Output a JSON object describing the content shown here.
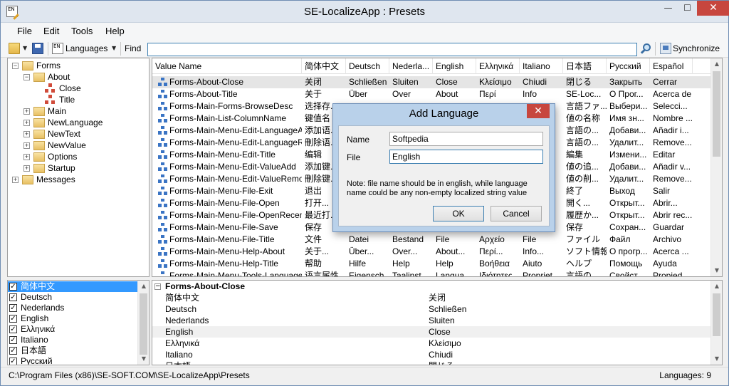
{
  "window": {
    "title": "SE-LocalizeApp : Presets",
    "icon_text": "EN",
    "min_symbol": "—",
    "max_symbol": "☐",
    "close_symbol": "✕"
  },
  "menu": [
    "File",
    "Edit",
    "Tools",
    "Help"
  ],
  "toolbar": {
    "languages_label": "Languages",
    "lang_icon_text": "EN",
    "find_label": "Find",
    "find_value": "",
    "sync_label": "Synchronize"
  },
  "tree": [
    {
      "label": "Forms",
      "expander": "−",
      "type": "folder"
    },
    {
      "label": "About",
      "expander": "−",
      "type": "folder"
    },
    {
      "label": "Close",
      "expander": "",
      "type": "leaf"
    },
    {
      "label": "Title",
      "expander": "",
      "type": "leaf"
    },
    {
      "label": "Main",
      "expander": "+",
      "type": "folder"
    },
    {
      "label": "NewLanguage",
      "expander": "+",
      "type": "folder"
    },
    {
      "label": "NewText",
      "expander": "+",
      "type": "folder"
    },
    {
      "label": "NewValue",
      "expander": "+",
      "type": "folder"
    },
    {
      "label": "Options",
      "expander": "+",
      "type": "folder"
    },
    {
      "label": "Startup",
      "expander": "+",
      "type": "folder"
    },
    {
      "label": "Messages",
      "expander": "+",
      "type": "folder"
    }
  ],
  "grid": {
    "columns": [
      "Value Name",
      "简体中文",
      "Deutsch",
      "Nederla...",
      "English",
      "Ελληνικά",
      "Italiano",
      "日本語",
      "Русский",
      "Español"
    ],
    "rows": [
      [
        "Forms-About-Close",
        "关闭",
        "Schließen",
        "Sluiten",
        "Close",
        "Κλείσιμο",
        "Chiudi",
        "閉じる",
        "Закрыть",
        "Cerrar"
      ],
      [
        "Forms-About-Title",
        "关于",
        "Über",
        "Over",
        "About",
        "Περί",
        "Info",
        "SE-Loc...",
        "О Прог...",
        "Acerca de"
      ],
      [
        "Forms-Main-Forms-BrowseDesc",
        "选择存...",
        "",
        "",
        "",
        "",
        "",
        "言語ファ...",
        "Выбери...",
        "Selecci..."
      ],
      [
        "Forms-Main-List-ColumnName",
        "键值名",
        "",
        "",
        "",
        "",
        "",
        "値の名称",
        "Имя зн...",
        "Nombre ..."
      ],
      [
        "Forms-Main-Menu-Edit-LanguageAdd",
        "添加语...",
        "",
        "",
        "",
        "",
        "",
        "言語の...",
        "Добави...",
        "Añadir i..."
      ],
      [
        "Forms-Main-Menu-Edit-LanguageRe...",
        "刪除语...",
        "",
        "",
        "",
        "",
        "",
        "言語の...",
        "Удалит...",
        "Remove..."
      ],
      [
        "Forms-Main-Menu-Edit-Title",
        "编辑",
        "",
        "",
        "",
        "",
        "",
        "編集",
        "Измени...",
        "Editar"
      ],
      [
        "Forms-Main-Menu-Edit-ValueAdd",
        "添加键...",
        "",
        "",
        "",
        "",
        "",
        "値の追...",
        "Добави...",
        "Añadir v..."
      ],
      [
        "Forms-Main-Menu-Edit-ValueRemove",
        "刪除键...",
        "",
        "",
        "",
        "",
        "",
        "値の削...",
        "Удалит...",
        "Remove..."
      ],
      [
        "Forms-Main-Menu-File-Exit",
        "退出",
        "",
        "",
        "",
        "",
        "",
        "終了",
        "Выход",
        "Salir"
      ],
      [
        "Forms-Main-Menu-File-Open",
        "打开...",
        "",
        "",
        "",
        "",
        "",
        "開く...",
        "Открыт...",
        "Abrir..."
      ],
      [
        "Forms-Main-Menu-File-OpenRecent",
        "最近打...",
        "",
        "",
        "",
        "",
        "",
        "履歴か...",
        "Открыт...",
        "Abrir rec..."
      ],
      [
        "Forms-Main-Menu-File-Save",
        "保存",
        "",
        "",
        "",
        "",
        "",
        "保存",
        "Сохран...",
        "Guardar"
      ],
      [
        "Forms-Main-Menu-File-Title",
        "文件",
        "Datei",
        "Bestand",
        "File",
        "Αρχείο",
        "File",
        "ファイル",
        "Файл",
        "Archivo"
      ],
      [
        "Forms-Main-Menu-Help-About",
        "关于...",
        "Über...",
        "Over...",
        "About...",
        "Περί...",
        "Info...",
        "ソフト情報",
        "О прогр...",
        "Acerca ..."
      ],
      [
        "Forms-Main-Menu-Help-Title",
        "帮助",
        "Hilfe",
        "Help",
        "Help",
        "Βοήθεια",
        "Aiuto",
        "ヘルプ",
        "Помощь",
        "Ayuda"
      ],
      [
        "Forms-Main-Menu-Tools-LanguageP...",
        "语言属性...",
        "Eigensch...",
        "Taalinst...",
        "Langua...",
        "Ιδιότητες...",
        "Propriet...",
        "言語の...",
        "Свойст...",
        "Propied..."
      ]
    ]
  },
  "languages": [
    {
      "label": "简体中文",
      "checked": true
    },
    {
      "label": "Deutsch",
      "checked": true
    },
    {
      "label": "Nederlands",
      "checked": true
    },
    {
      "label": "English",
      "checked": true
    },
    {
      "label": "Ελληνικά",
      "checked": true
    },
    {
      "label": "Italiano",
      "checked": true
    },
    {
      "label": "日本語",
      "checked": true
    },
    {
      "label": "Русский",
      "checked": true
    }
  ],
  "details": {
    "title": "Forms-About-Close",
    "rows": [
      {
        "lang": "简体中文",
        "value": "关闭"
      },
      {
        "lang": "Deutsch",
        "value": "Schließen"
      },
      {
        "lang": "Nederlands",
        "value": "Sluiten"
      },
      {
        "lang": "English",
        "value": "Close"
      },
      {
        "lang": "Ελληνικά",
        "value": "Κλείσιμο"
      },
      {
        "lang": "Italiano",
        "value": "Chiudi"
      },
      {
        "lang": "日本語",
        "value": "閉じる"
      }
    ]
  },
  "status": {
    "path": "C:\\Program Files (x86)\\SE-SOFT.COM\\SE-LocalizeApp\\Presets",
    "count": "Languages: 9"
  },
  "dialog": {
    "title": "Add Language",
    "name_label": "Name",
    "name_value": "Softpedia",
    "file_label": "File",
    "file_value": "English",
    "note": "Note: file name should be in english, while language name could be any non-empty localized string value",
    "ok_label": "OK",
    "cancel_label": "Cancel",
    "close_symbol": "✕"
  },
  "colors": {
    "selection": "#3399ff",
    "close_red": "#c7463e",
    "dialog_frame": "#b9d1ea"
  }
}
